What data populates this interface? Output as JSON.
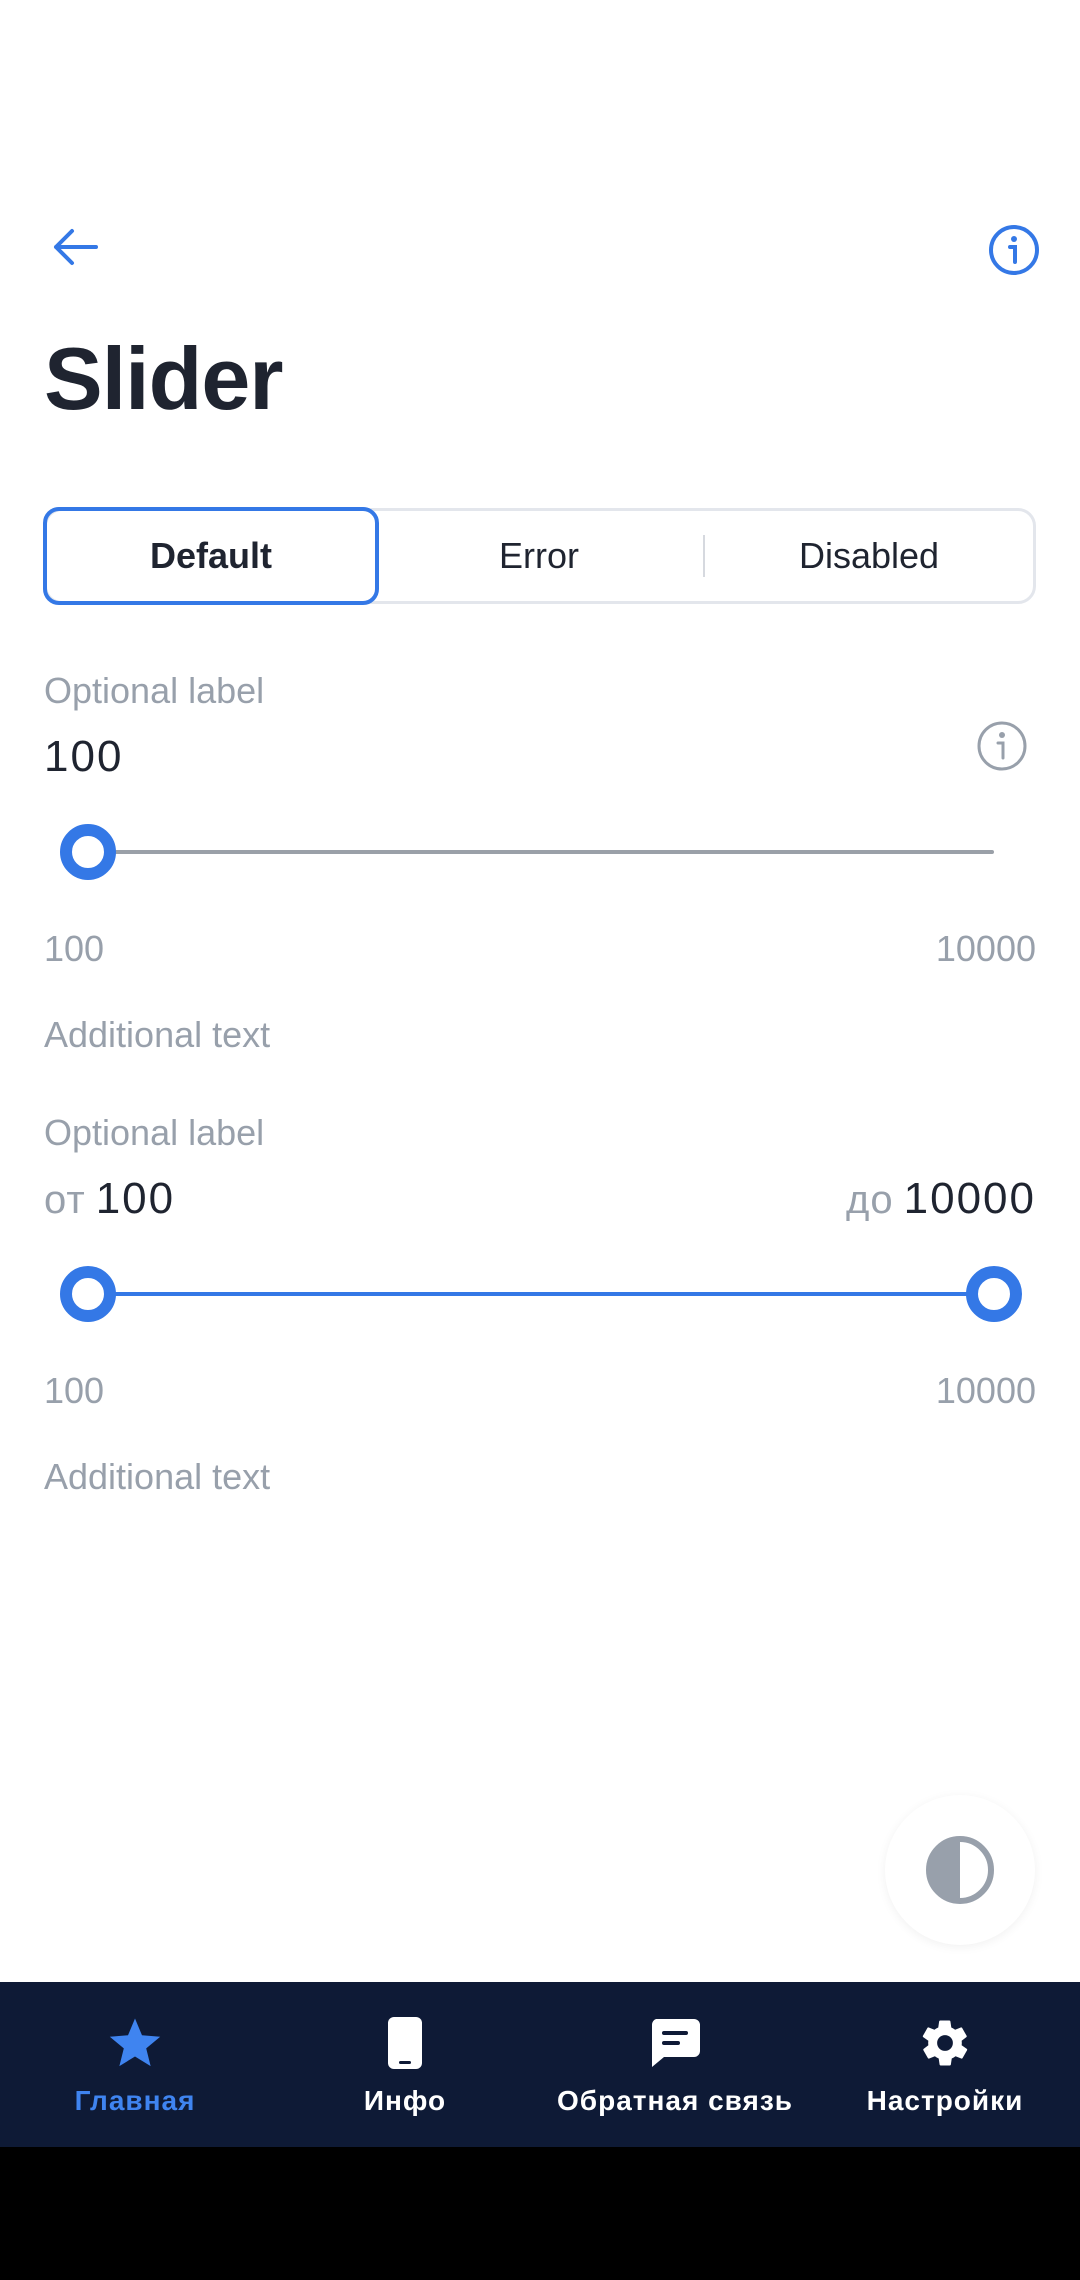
{
  "header": {
    "back_icon": "arrow-left-icon",
    "info_icon": "info-circle-icon",
    "title": "Slider"
  },
  "tabs": [
    {
      "label": "Default",
      "active": true
    },
    {
      "label": "Error",
      "active": false
    },
    {
      "label": "Disabled",
      "active": false
    }
  ],
  "slider_single": {
    "label": "Optional label",
    "value": "100",
    "min_label": "100",
    "max_label": "10000",
    "helper": "Additional text",
    "position": 0.0
  },
  "slider_range": {
    "label": "Optional label",
    "from_prefix": "от",
    "from_value": "100",
    "to_prefix": "до",
    "to_value": "10000",
    "min_label": "100",
    "max_label": "10000",
    "helper": "Additional text",
    "from_position": 0.0,
    "to_position": 1.0
  },
  "theme_toggle_icon": "contrast-icon",
  "nav": [
    {
      "label": "Главная",
      "icon": "star-icon",
      "active": true
    },
    {
      "label": "Инфо",
      "icon": "phone-icon",
      "active": false
    },
    {
      "label": "Обратная связь",
      "icon": "chat-icon",
      "active": false
    },
    {
      "label": "Настройки",
      "icon": "gear-icon",
      "active": false
    }
  ],
  "colors": {
    "accent": "#3478e6",
    "nav_bg": "#0e1a36",
    "muted": "#98a0ab",
    "text": "#1f2430"
  }
}
